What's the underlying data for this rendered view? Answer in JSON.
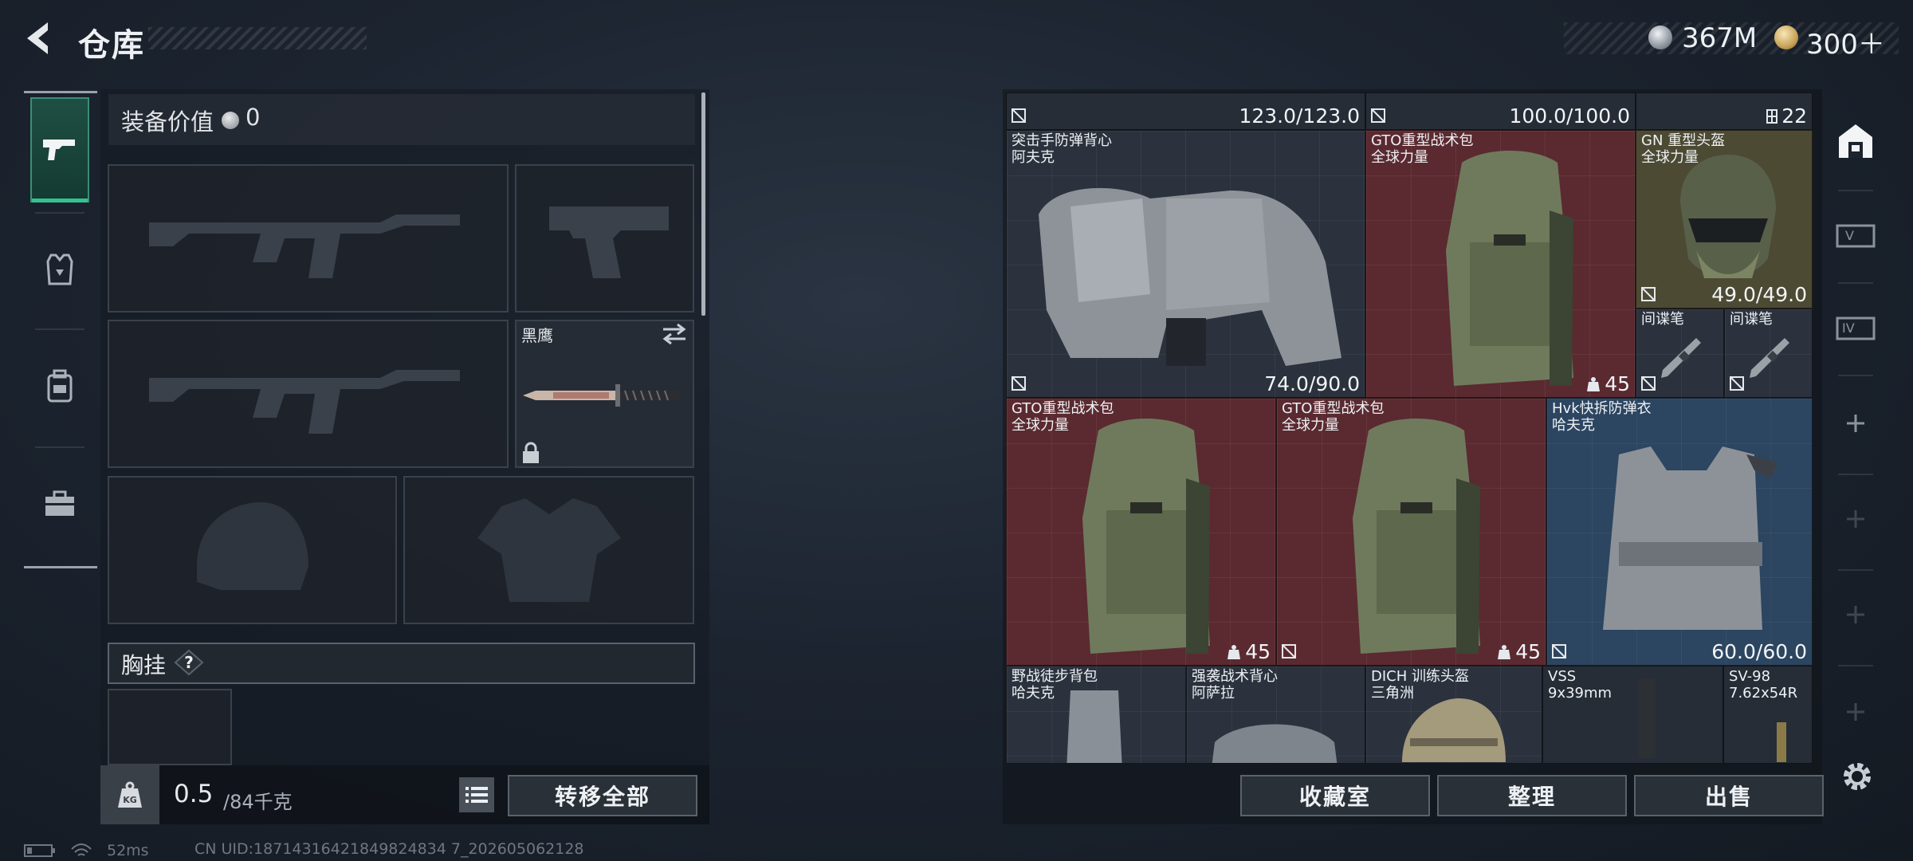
{
  "header": {
    "title": "仓库",
    "currency_a": "367M",
    "currency_b": "300＋"
  },
  "loadout": {
    "equipment_value_label": "装备价值",
    "equipment_value": "0",
    "melee_name": "黑鹰",
    "chest_rig_label": "胸挂",
    "weight_current": "0.5",
    "weight_max": "/84千克",
    "transfer_all_label": "转移全部"
  },
  "storage": {
    "items": [
      {
        "id": "top1",
        "value": "123.0/123.0"
      },
      {
        "id": "top2",
        "value": "100.0/100.0"
      },
      {
        "id": "top3",
        "value": "22"
      },
      {
        "id": "vest1",
        "name": "突击手防弹背心",
        "brand": "阿夫克",
        "value": "74.0/90.0"
      },
      {
        "id": "bag1",
        "name": "GTO重型战术包",
        "brand": "全球力量",
        "value": "45"
      },
      {
        "id": "helmet1",
        "name": "GN 重型头盔",
        "brand": "全球力量",
        "value": "49.0/49.0"
      },
      {
        "id": "pen1",
        "name": "间谍笔"
      },
      {
        "id": "pen2",
        "name": "间谍笔"
      },
      {
        "id": "bag2",
        "name": "GTO重型战术包",
        "brand": "全球力量",
        "value": "45"
      },
      {
        "id": "bag3",
        "name": "GTO重型战术包",
        "brand": "全球力量",
        "value": "45"
      },
      {
        "id": "vest2",
        "name": "Hvk快拆防弹衣",
        "brand": "哈夫克",
        "value": "60.0/60.0"
      },
      {
        "id": "pack1",
        "name": "野战徒步背包",
        "brand": "哈夫克"
      },
      {
        "id": "vest3",
        "name": "强袭战术背心",
        "brand": "阿萨拉"
      },
      {
        "id": "helmet2",
        "name": "DICH 训练头盔",
        "brand": "三角洲"
      },
      {
        "id": "ammo1",
        "name": "VSS",
        "brand": "9x39mm"
      },
      {
        "id": "ammo2",
        "name": "SV-98",
        "brand": "7.62x54R"
      }
    ],
    "storage_room_label": "收藏室",
    "sort_label": "整理",
    "sell_label": "出售"
  },
  "status": {
    "ping": "52ms",
    "uid": "CN UID:18714316421849824834 7_202605062128"
  },
  "colors": {
    "accent_green": "#34c38f",
    "rarity_red": "#5a2a30",
    "rarity_gold": "#4c4a33",
    "rarity_blue": "#2c4560"
  }
}
